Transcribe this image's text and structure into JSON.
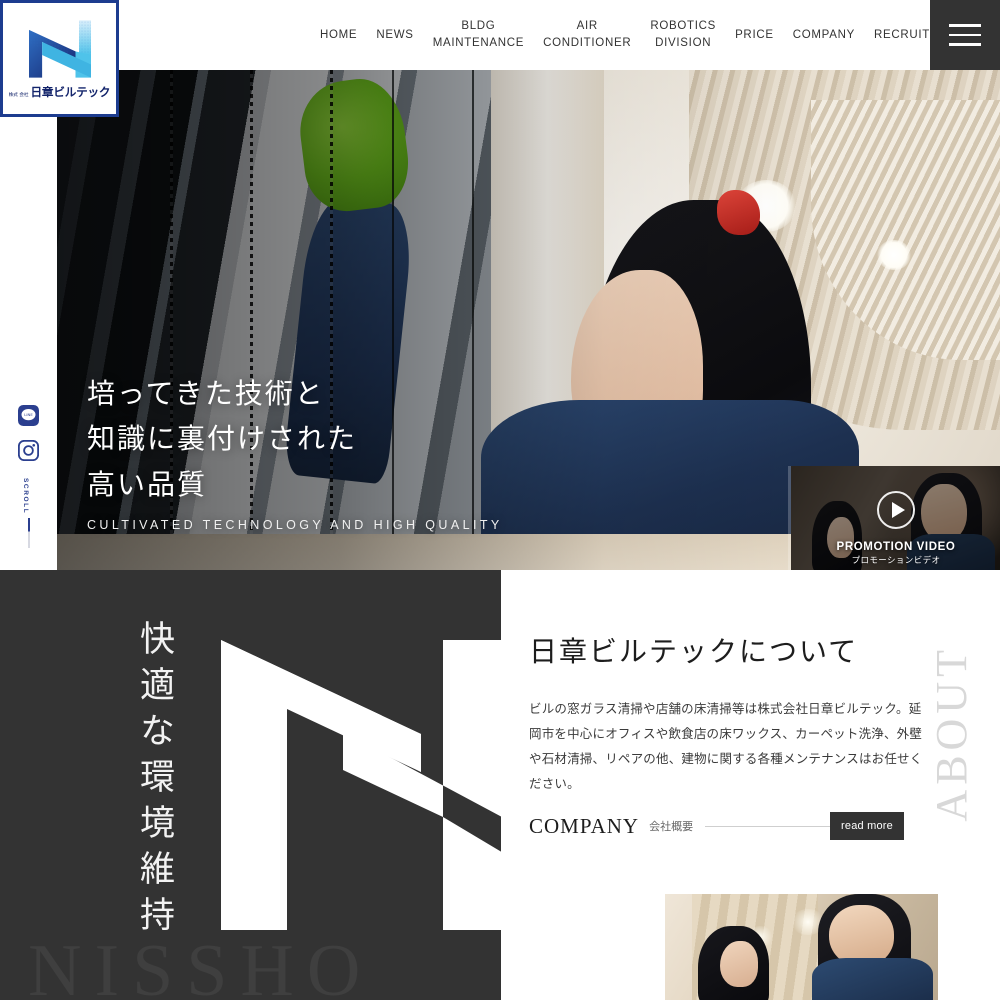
{
  "header": {
    "logo": {
      "prefix": "株式\n会社",
      "name": "日章ビルテック",
      "icon": "nissho-n-logo-icon"
    },
    "nav": [
      {
        "label": "HOME"
      },
      {
        "label": "NEWS"
      },
      {
        "label": "BLDG\nMAINTENANCE"
      },
      {
        "label": "AIR\nCONDITIONER"
      },
      {
        "label": "ROBOTICS\nDIVISION"
      },
      {
        "label": "PRICE"
      },
      {
        "label": "COMPANY"
      },
      {
        "label": "RECRUIT"
      }
    ],
    "menu_button": "hamburger-menu-icon"
  },
  "rail": {
    "line_icon": "line-icon",
    "instagram_icon": "instagram-icon",
    "scroll_label": "SCROLL"
  },
  "hero": {
    "line1": "培ってきた技術と",
    "line2": "知識に裏付けされた",
    "line3": "高い品質",
    "subtitle": "CULTIVATED TECHNOLOGY AND HIGH QUALITY",
    "video": {
      "title_en": "PROMOTION VIDEO",
      "title_jp": "プロモーションビデオ",
      "play_icon": "play-icon"
    }
  },
  "about": {
    "vertical_catch": "快適な環境維持",
    "watermark": "NISSHO",
    "side_label": "ABOUT",
    "heading": "日章ビルテックについて",
    "body": "ビルの窓ガラス清掃や店舗の床清掃等は株式会社日章ビルテック。延岡市を中心にオフィスや飲食店の床ワックス、カーペット洗浄、外壁や石材清掃、リペアの他、建物に関する各種メンテナンスはお任せください。",
    "cta_en": "COMPANY",
    "cta_jp": "会社概要",
    "cta_button": "read more"
  },
  "colors": {
    "brand_navy": "#13246b",
    "brand_blue": "#2b3f8f",
    "dark_panel": "#333333",
    "accent_cyan": "#4fc3ea"
  }
}
